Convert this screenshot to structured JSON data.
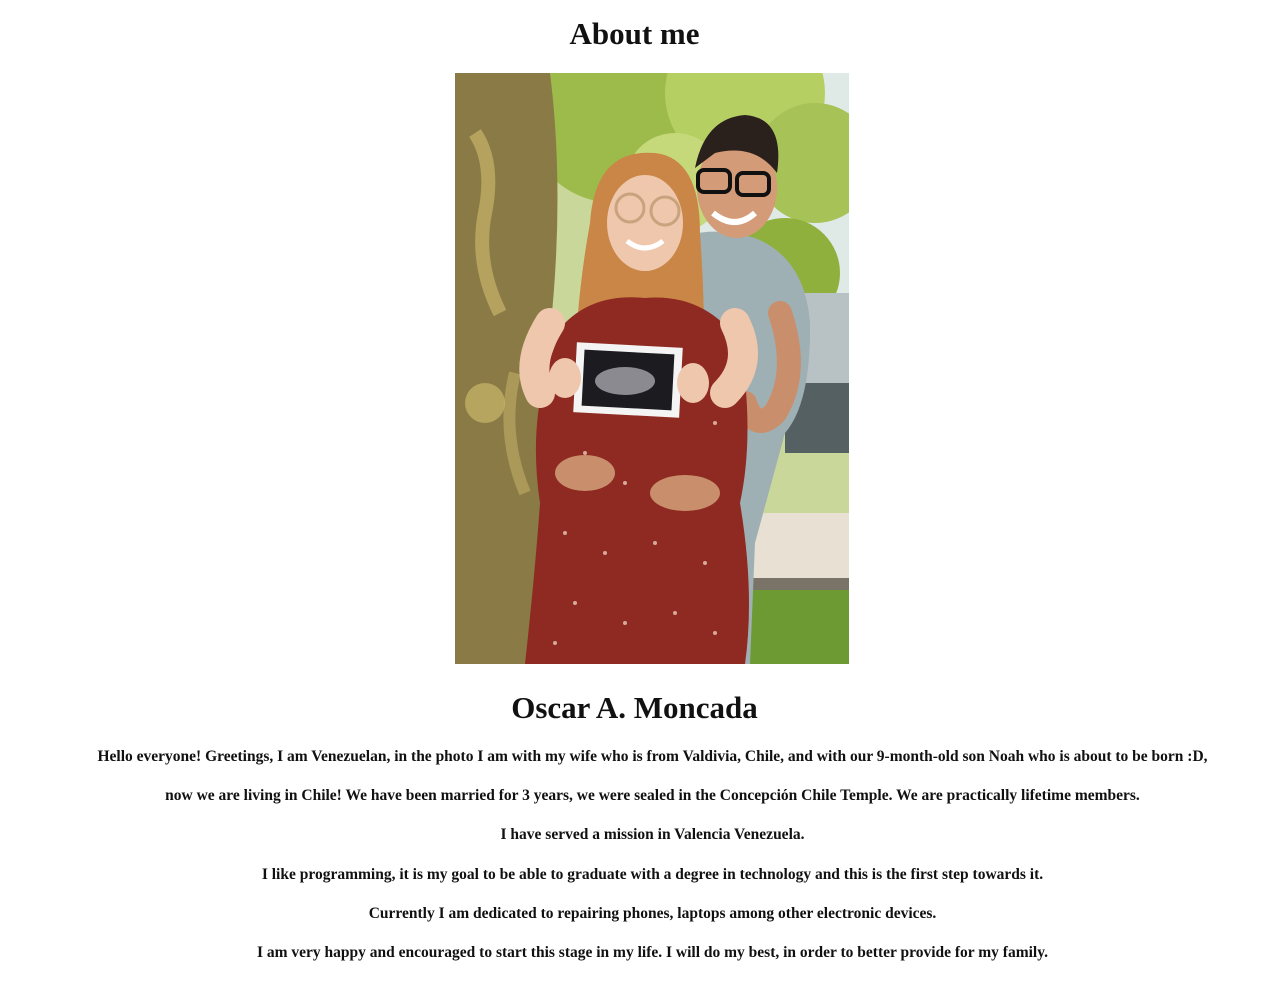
{
  "page": {
    "title": "About me",
    "photo_alt": "Photo of Oscar with his wife holding an ultrasound picture",
    "name": "Oscar A. Moncada",
    "bio": [
      "Hello everyone! Greetings, I am Venezuelan, in the photo I am with my wife who is from Valdivia, Chile, and with our 9-month-old son Noah who is about to be born :D,",
      "now we are living in Chile! We have been married for 3 years, we were sealed in the Concepción Chile Temple. We are practically lifetime members.",
      "I have served a mission in Valencia Venezuela.",
      "I like programming, it is my goal to be able to graduate with a degree in technology and this is the first step towards it.",
      "Currently I am dedicated to repairing phones, laptops among other electronic devices.",
      "I am very happy and encouraged to start this stage in my life. I will do my best, in order to better provide for my family."
    ]
  },
  "colors": {
    "background": "#ffffff",
    "text": "#111111",
    "foliage": "#8fb03c",
    "tree_trunk": "#8a7a45",
    "dress": "#8e2a22",
    "shirt": "#9fb0b4"
  }
}
